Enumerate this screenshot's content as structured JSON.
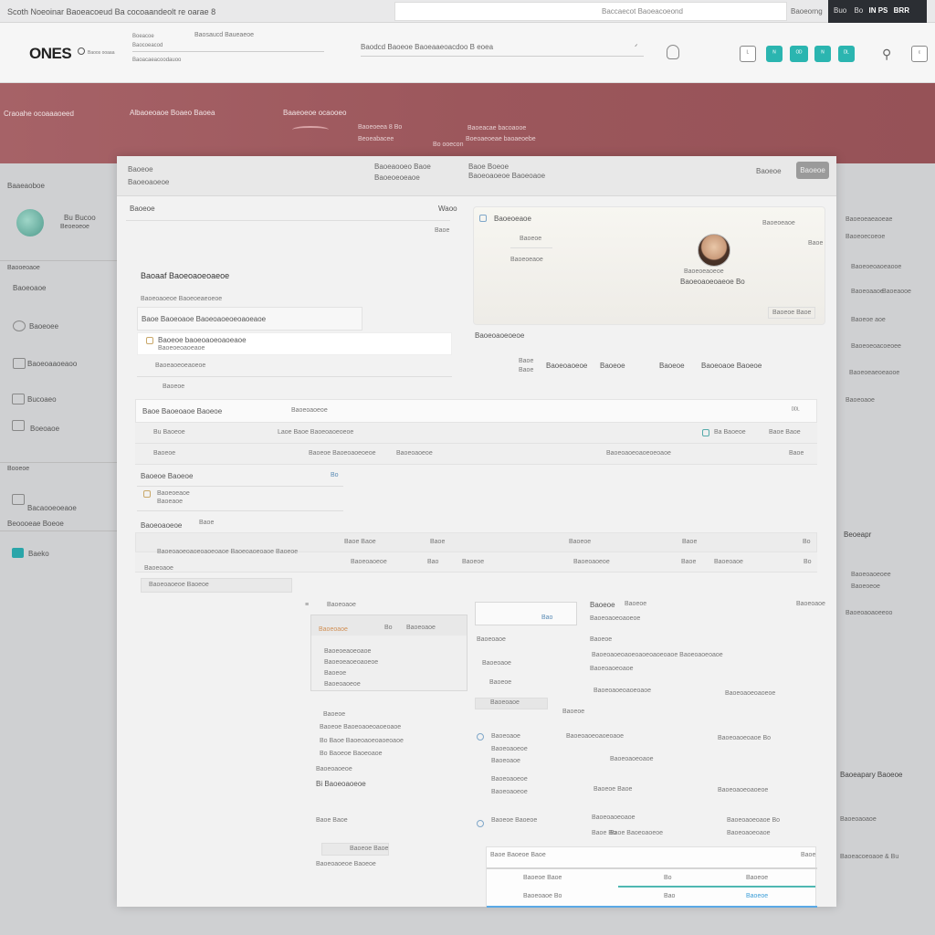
{
  "browser": {
    "tab_title": "Scoth Noeoinar Baoeacoeud Ba cocoaandeolt re oarae 8",
    "address": "Baccaecot Baoeacoeond",
    "right_text": "Baoeorng",
    "dark_box": {
      "a": "Buo",
      "b": "Bo",
      "c": "IN PS",
      "d": "BRR"
    }
  },
  "header": {
    "logo": "ONES",
    "logo_sub": "Baoos ooaaa",
    "left_lines": [
      "Boeacoe",
      "Baocoeacod",
      "Baoacaeacoodauoo"
    ],
    "left_right": "Baosaucd Baueaeoe",
    "center_text": "Baodcd Baoeoe Baoeaaeoacdoo B eoea",
    "center_chev": "ᐟ",
    "btn1": "ᴸ",
    "btn2": "ᴺ",
    "btn3": "ᴼᴰ",
    "btn4": "ᴺ",
    "btn5": "ᴰᴸ",
    "btn6": "ᶜ"
  },
  "banner": {
    "c1": "Craoahe ocoaaaoeed",
    "c2": "Albaoeoaoe Boaeo Baoea",
    "c3": "Baaeoeoe ocaooeo",
    "c4a": "Baoeoeea 8 Bo",
    "c4b": "Beoeabacee",
    "c5a": "Baoeacae bacoaooe",
    "c5b": "Boeoaeoeae baoaeoebe",
    "c6": "Bo ooecon"
  },
  "sidebar": {
    "title": "Baaeaoboe",
    "user_line1": "Bu Bucoo",
    "user_line2": "Beoeoeoe",
    "section": "Baooeoaoe",
    "item1": "Baoeoaoe",
    "item2": "Baoeoee",
    "item3": "Baoeoaaoeaoo",
    "item4": "Bucoaeo",
    "item5": "Boeoaoe",
    "section2": "Booeoe",
    "item6": "Bacaooeoeaoe",
    "item7": "Beoooeae Boeoe",
    "item8": "Baeko"
  },
  "right_panel": {
    "r1": "Baoeoeaeaoeae",
    "r2": "Baoeoecoeoe",
    "r3": "Baoeoeoaoeaooe",
    "r4a": "Baoeoaaoe",
    "r4b": "Baoeaooe",
    "r5": "Baoeoe  aoe",
    "r6": "Baoeoeoacoeoee",
    "r7": "Baoeoeaeoeaooe",
    "r8": "Baoeoaoe",
    "r9": "Beoeapr",
    "r10": "Baoeoaoeoee",
    "r11": "Baoeoeoe",
    "r12": "Baoeoaoaoeeoo",
    "r13": "Baoeapary Baoeoe",
    "r14": "Baoeoaoaoe",
    "r15": "Baoeacoeoaoe & Bu"
  },
  "modal": {
    "head_a": "Baoeoe",
    "head_b": "Baoeoaoeoe",
    "head_c": "Baoeaooeo Baoe",
    "head_d": "Baoeoeoeaoe",
    "head_e": "Baoe Boeoe",
    "head_f": "Baoeoaoeoe Baoeoaoe",
    "head_g": "Baoeoe",
    "close": "Baoeoe",
    "left_label": "Baoeoe",
    "left_right": "Waoo",
    "left_right2": "Baoe",
    "section_title": "Baoaaf Baoeoaoeoaeoe",
    "section_sub": "Baoeoaoeoe Baoeoeaeoeoe",
    "opt1": "Baoe Baoeoaoe Baoeoaoeoeoaoeaoe",
    "opt2": "Baoeoe baoeoaoeoaoeaoe",
    "opt2_sub": "Baoeoeoaoeaoe",
    "opt3": "Baoeaoeoeaoeoe",
    "opt4": "Baoeoe",
    "card_title": "Baoeoeaoe",
    "card_r1": "Baoeoeaoe",
    "card_r2": "Baoe",
    "card_l1": "Baoeoe",
    "card_l2": "Baoeoeaoe",
    "card_name": "Baoeoeaoeoe",
    "card_sub": "Baoeoaoeoaeoe Bo",
    "card_btn": "Baoeoe Baoe",
    "stats_title": "Baoeoaoeoeoe",
    "stat1a": "Baoe",
    "stat1b": "Baoe",
    "stat2": "Baoeoaoeoe",
    "stat3": "Baoeoe",
    "stat4": "Baoeoe",
    "stat5": "Baoeoaoe Baoeoe",
    "tb1_a": "Baoe Baoeoaoe Baoeoe",
    "tb1_b": "Baoeoaoeoe",
    "tb1_c": "ᴰᴰᴸ",
    "row1_a": "Bu Baoeoe",
    "row1_b": "Laoe Baoe Baoeoaoeoeoe",
    "row1_c": "Ba Baoeoe",
    "row1_d": "Baoe Baoe",
    "row2_a": "Baoeoe",
    "row2_b": "Baoeoe Baoeoaoeoeoe",
    "row2_c": "Baoeoaoeoe",
    "row2_d": "Baoeoaoeoaoeoeoaoe",
    "row2_e": "Baoe",
    "sub_head": "Baoeoe Baoeoe",
    "sub_head_r": "Bo",
    "sub_item": "Baoeoeaoe",
    "sub_item2": "Baoeaoe",
    "tb2_title": "Baoeoaoeoe",
    "tb2_r": "Baoe",
    "th1": "Baoe Baoe",
    "th2": "Baoe",
    "th3": "Baoeoe",
    "th4": "Baoe",
    "th5": "Bo",
    "tr1": "Baoeoaoeoaoeoaoeoaoe Baoeoaoeoaoe Baoeoe",
    "tr2": "Baoeoaoeoe",
    "tr3": "Bao",
    "tr4": "Baoeoe",
    "tr5": "Baoeoaoeoe",
    "tr6": "Baoe",
    "tr7": "Baoeoaoe",
    "tr8": "Bo",
    "b1": "Baoeoaoe",
    "b2": "Baoeoaoeoe Baoeoe",
    "pl_title": "Baoeoaoe",
    "pl_a": "Baoeoaoe",
    "pl_b": "Bo",
    "pl_c": "Baoeoaoe",
    "pl_l1": "Baoeoeaoeoaoe",
    "pl_l2": "Baoeoeaoeoaoeoe",
    "pl_l3": "Baoeoe",
    "pl_l4": "Baoeoaoeoe",
    "pm_a": "Baoeoe",
    "pm_b": "Baoeoe Baoeoaoeoaoeoaoe",
    "pm_c": "Bo Baoe Baoeoaoeoaoeoaoe",
    "pm_d": "Bo Baoeoe Baoeoaoe",
    "pm_e": "Baoeoaoeoe",
    "pm_f": "Bi Baoeoaoeoe",
    "pm_g": "Baoe Baoe",
    "pm_h": "Baoeoe Baoe",
    "pm_i": "Baoeoaoeoe Baoeoe",
    "mid_a": "Bao",
    "mid_b": "Baoeoaoe",
    "mid_c": "Baoeoaoe",
    "mid_d": "Baoeoe",
    "mid_e": "Baoeoaoe",
    "mid_f": "Baoeoe",
    "mid_g": "Baoeoaoe",
    "mid_h": "Baoeoaoeoe",
    "mid_i": "Baoeoaoe",
    "mid_j": "Baoeoaoeoe",
    "mid_k": "Baoeoaoeoe",
    "mid_l": "Baoeoe Baoeoe",
    "rt_a": "Baoeoe",
    "rt_b": "Baoeoe",
    "rt_c": "Baoeoaoe",
    "rt_d": "Baoeoaoeoaoeoe",
    "rt_e": "Baoeoaoeoaoeoaoeoaoeoaoe  Baoeoaoeoaoe",
    "rt_f": "Baoeoe",
    "rt_g": "Baoeoaoeoaoe",
    "rt_h": "Baoeoaoeoaoeoaoe",
    "rt_i": "Baoeoaoeoaoeoe",
    "rt_j": "Baoeoaoeoaoeoaoe",
    "rt_k": "Baoeoaoeoaoe Bo",
    "rt_l": "Baoeoaoeoaoe",
    "rt_m": "Baoeoe Baoe",
    "rt_n": "Baoeoaoeoaoeoe",
    "rt_o": "Baoeoaoeoaoe",
    "rt_p": "Baoeoaoeoaoe Bo",
    "rt_q": "Baoe Bo",
    "rt_r": "Baoe Baoeoaoeoe",
    "rt_s": "Baoeoaoeoaoe",
    "bot_title": "Baoe Baoeoe Baoe",
    "bot_r": "Baoe",
    "bot_a": "Baoeoe Baoe",
    "bot_b": "Bo",
    "bot_c": "Baoeoe",
    "bot_d": "Baoeoaoe Bo",
    "bot_e": "Bao",
    "bot_f": "Baoeoe"
  }
}
